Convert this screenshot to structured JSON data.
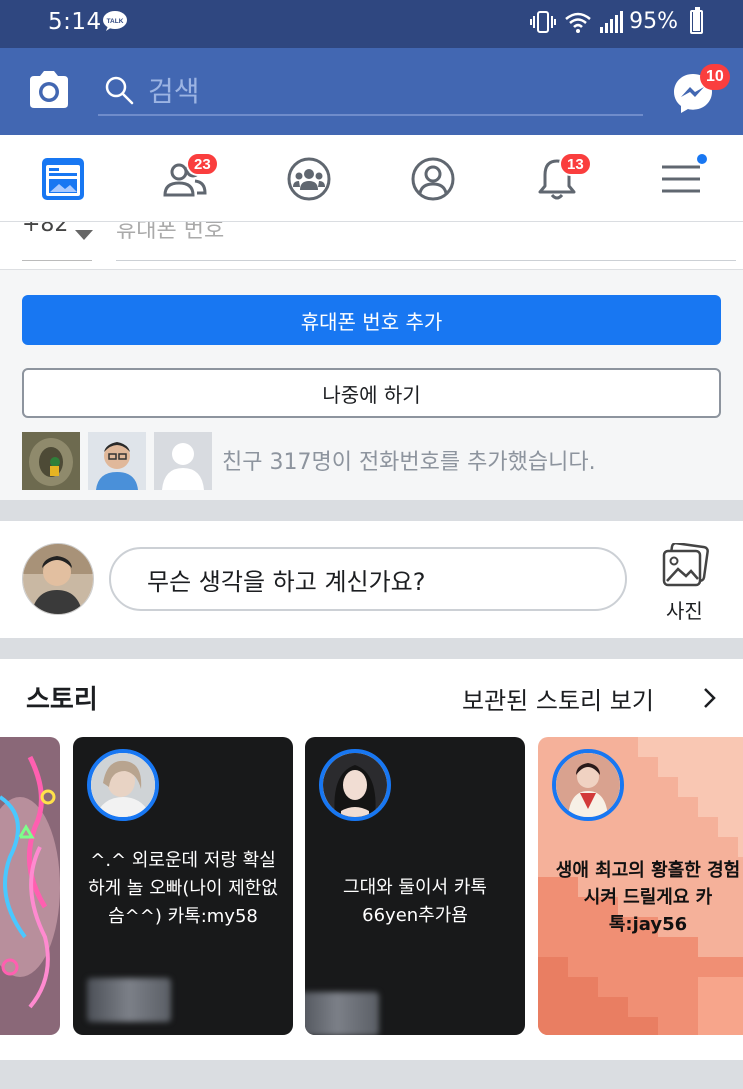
{
  "status_bar": {
    "time": "5:14",
    "talk_label": "TALK",
    "battery": "95%"
  },
  "top_bar": {
    "search_placeholder": "검색",
    "messenger_badge": "10"
  },
  "nav": {
    "friends_badge": "23",
    "notifications_badge": "13"
  },
  "phone_prompt": {
    "country_code": "+82",
    "phone_placeholder": "휴대폰 번호",
    "add_button": "휴대폰 번호 추가",
    "later_button": "나중에 하기",
    "friends_text": "친구 317명이 전화번호를 추가했습니다."
  },
  "composer": {
    "placeholder": "무슨 생각을 하고 계신가요?",
    "photo_label": "사진"
  },
  "stories": {
    "title": "스토리",
    "archive_link": "보관된 스토리 보기",
    "items": [
      {
        "text": ""
      },
      {
        "text": "^.^ 외로운데 저랑 확실하게 놀 오빠(나이 제한없슴^^) 카톡:my58"
      },
      {
        "text": "그대와 둘이서 카톡 66yen추가욤"
      },
      {
        "text": "생애 최고의 황홀한 경험 시켜 드릴게요 카톡:jay56"
      }
    ]
  },
  "colors": {
    "status_bar": "#2f4780",
    "top_bar": "#4267b2",
    "accent": "#1877f2",
    "badge": "#fa3e3e"
  }
}
